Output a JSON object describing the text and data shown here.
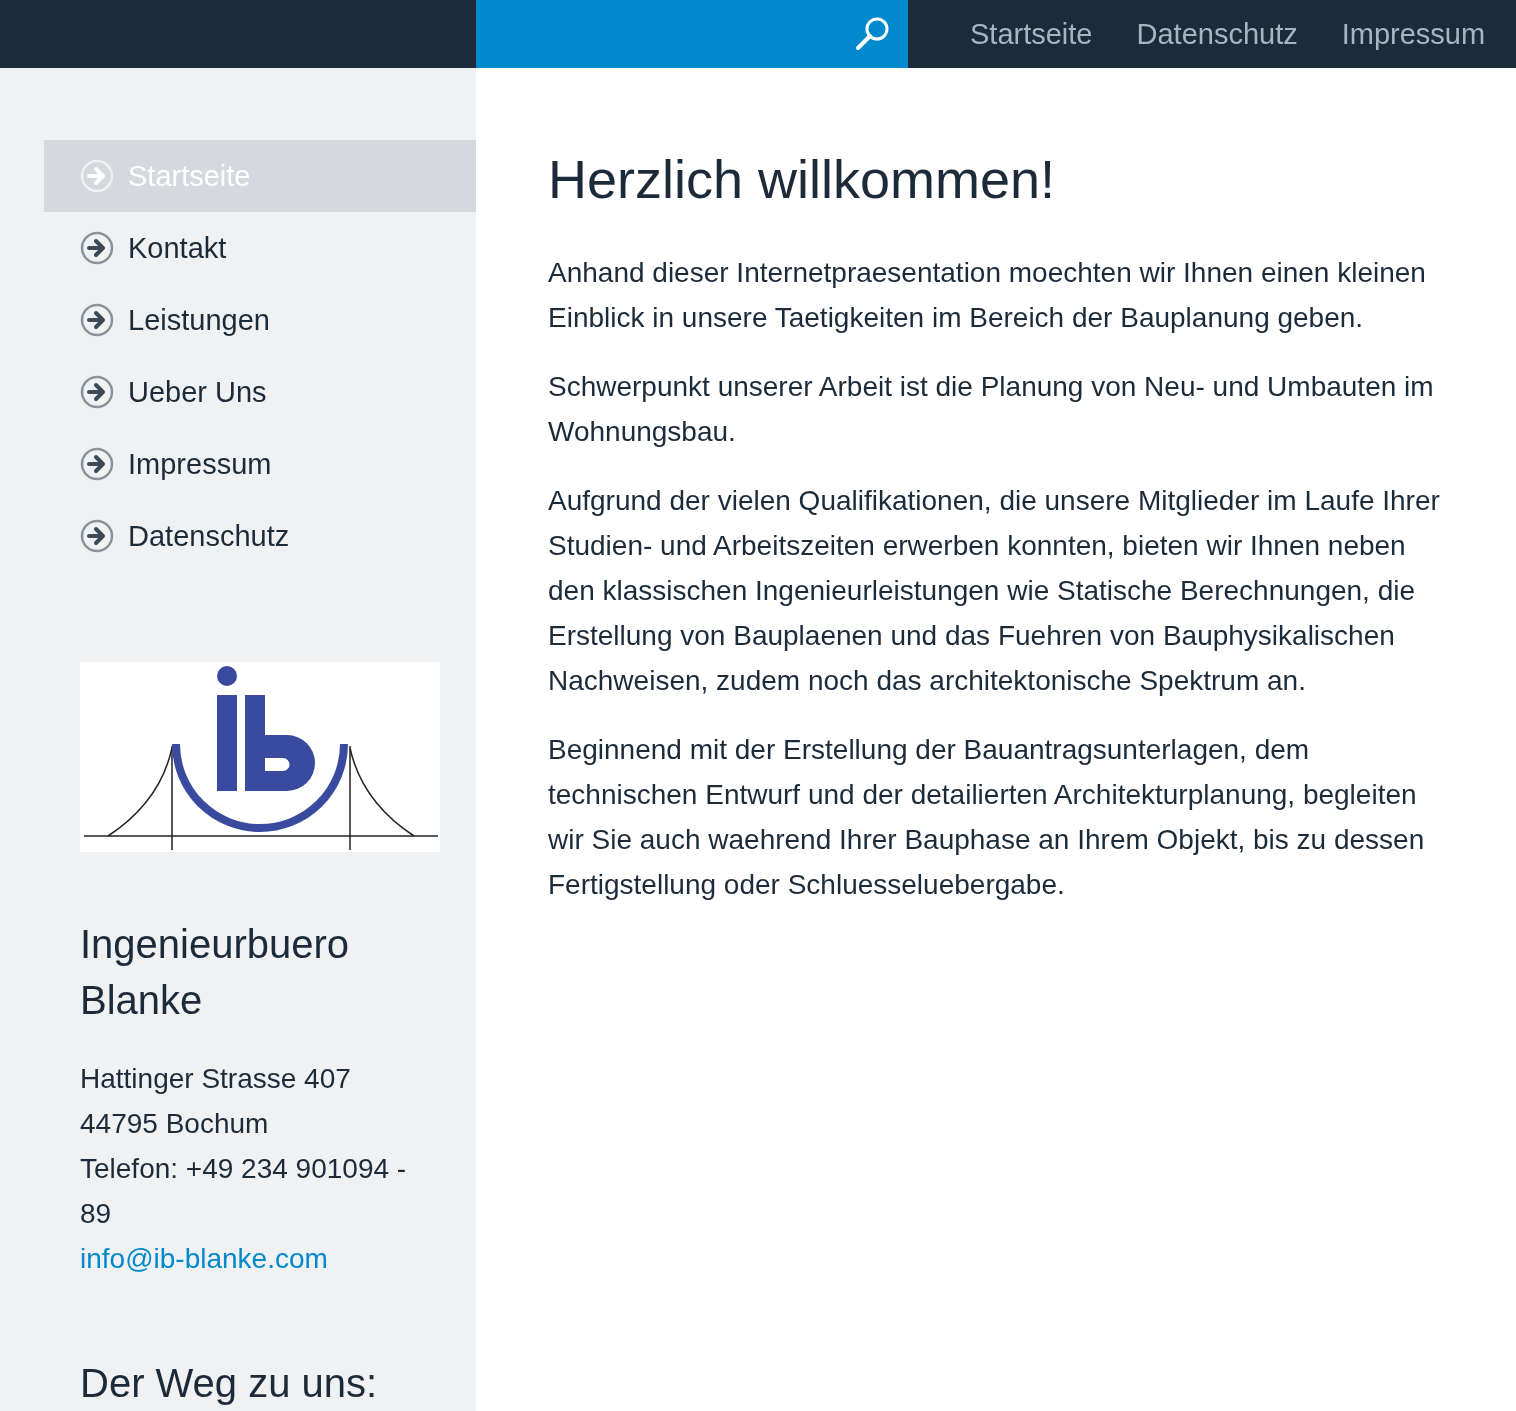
{
  "header": {
    "nav": [
      {
        "label": "Startseite"
      },
      {
        "label": "Datenschutz"
      },
      {
        "label": "Impressum"
      }
    ]
  },
  "sidebar": {
    "items": [
      {
        "label": "Startseite",
        "selected": true
      },
      {
        "label": "Kontakt",
        "selected": false
      },
      {
        "label": "Leistungen",
        "selected": false
      },
      {
        "label": "Ueber Uns",
        "selected": false
      },
      {
        "label": "Impressum",
        "selected": false
      },
      {
        "label": "Datenschutz",
        "selected": false
      }
    ],
    "company": {
      "name": "Ingenieurbuero Blanke",
      "address": [
        "Hattinger Strasse 407",
        "44795 Bochum",
        "Telefon: +49 234 901094 - 89"
      ],
      "email": "info@ib-blanke.com"
    },
    "directions_heading": "Der Weg zu uns:"
  },
  "main": {
    "title": "Herzlich willkommen!",
    "paragraphs": [
      "Anhand dieser Internetpraesentation moechten wir Ihnen einen kleinen Einblick in unsere Taetigkeiten im Bereich der Bauplanung geben.",
      "Schwerpunkt unserer Arbeit ist die Planung von Neu- und Umbauten im Wohnungsbau.",
      "Aufgrund der vielen Qualifikationen, die unsere Mitglieder im Laufe Ihrer Studien- und Arbeitszeiten erwerben konnten, bieten wir Ihnen neben den klassischen Ingenieurleistungen wie Statische Berechnungen, die Erstellung von Bauplaenen und das Fuehren von Bauphysikalischen Nachweisen, zudem noch das architektonische Spektrum an.",
      "Beginnend mit der Erstellung der Bauantragsunterlagen, dem technischen Entwurf und der detailierten Architekturplanung, begleiten wir Sie auch waehrend Ihrer Bauphase an Ihrem Objekt, bis zu dessen Fertigstellung oder Schluesseluebergabe."
    ]
  }
}
